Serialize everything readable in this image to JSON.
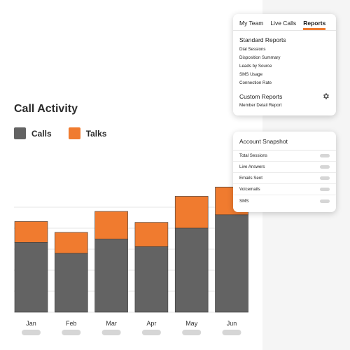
{
  "colors": {
    "calls": "#636363",
    "talks": "#f07b2f",
    "accent": "#f07b2f",
    "grid": "#e4e4e4",
    "pill": "#d6d6d6"
  },
  "chart": {
    "title": "Call Activity"
  },
  "legend": [
    {
      "label": "Calls",
      "color": "#636363"
    },
    {
      "label": "Talks",
      "color": "#f07b2f"
    }
  ],
  "chart_data": {
    "type": "bar",
    "stacked": true,
    "categories": [
      "Jan",
      "Feb",
      "Mar",
      "Apr",
      "May",
      "Jun"
    ],
    "series": [
      {
        "name": "Calls",
        "values": [
          83,
          70,
          87,
          78,
          100,
          116
        ]
      },
      {
        "name": "Talks",
        "values": [
          25,
          25,
          33,
          29,
          38,
          33
        ]
      }
    ],
    "ylim": [
      0,
      150
    ],
    "grid": true,
    "legend_position": "top-left"
  },
  "reports_card": {
    "tabs": [
      {
        "label": "My Team",
        "active": false
      },
      {
        "label": "Live Calls",
        "active": false
      },
      {
        "label": "Reports",
        "active": true
      }
    ],
    "standard_title": "Standard Reports",
    "standard_items": [
      "Dial Sessions",
      "Disposition Summary",
      "Leads by Source",
      "SMS Usage",
      "Connection Rate"
    ],
    "custom_title": "Custom Reports",
    "custom_items": [
      "Member Detail Report"
    ]
  },
  "snapshot_card": {
    "title": "Account Snapshot",
    "rows": [
      "Total Sessions",
      "Live Answers",
      "Emails Sent",
      "Voicemails",
      "SMS"
    ]
  }
}
